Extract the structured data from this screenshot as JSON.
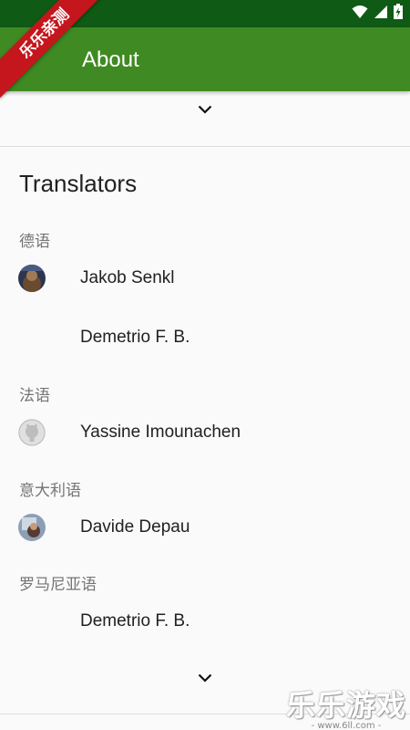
{
  "app_bar": {
    "title": "About",
    "color": "#3f8a22"
  },
  "status_bar": {
    "color": "#0f5a14",
    "icons": [
      "wifi-icon",
      "signal-icon",
      "battery-icon"
    ]
  },
  "ribbon": {
    "label": "乐乐亲测"
  },
  "section": {
    "title": "Translators"
  },
  "languages": [
    {
      "label": "德语"
    },
    {
      "label": "法语"
    },
    {
      "label": "意大利语"
    },
    {
      "label": "罗马尼亚语"
    }
  ],
  "translators": [
    {
      "name": "Jakob Senkl",
      "avatar": "photo-avatar"
    },
    {
      "name": "Demetrio F. B.",
      "avatar": "none"
    },
    {
      "name": "Yassine Imounachen",
      "avatar": "github-icon"
    },
    {
      "name": "Davide Depau",
      "avatar": "photo-avatar"
    },
    {
      "name": "Demetrio F. B.",
      "avatar": "none"
    }
  ],
  "watermark": {
    "main": "乐乐游戏",
    "sub": "- www.6ll.com -"
  }
}
